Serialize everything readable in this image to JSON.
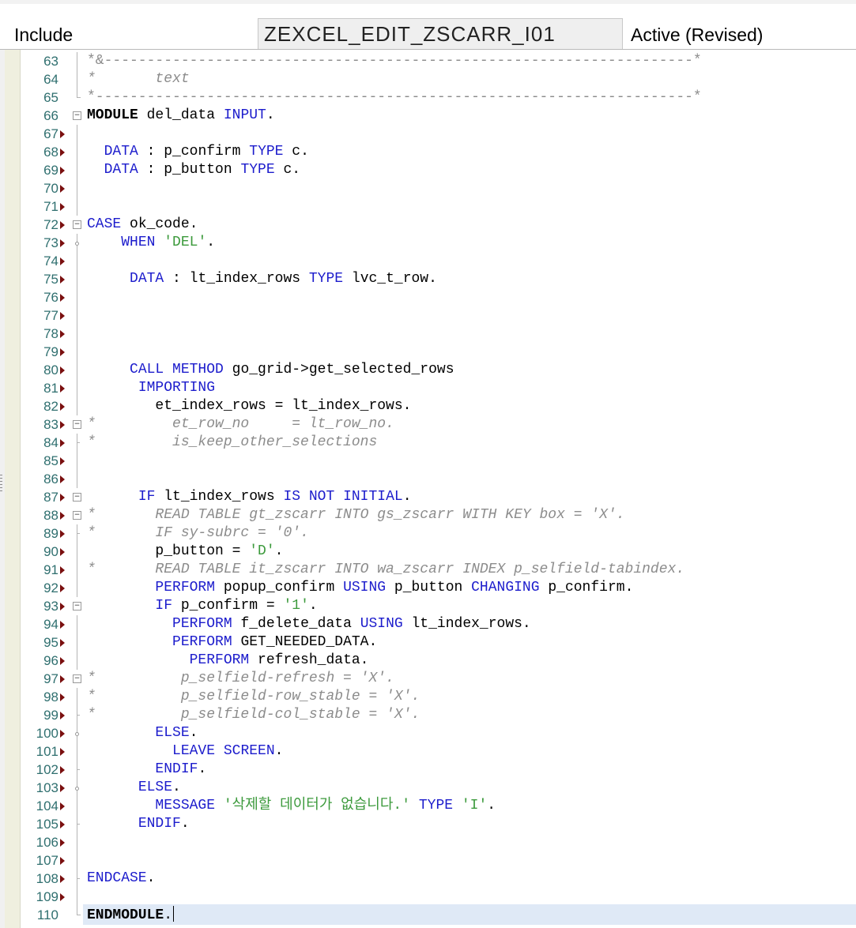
{
  "header": {
    "label": "Include",
    "program": "ZEXCEL_EDIT_ZSCARR_I01",
    "status": "Active (Revised)"
  },
  "editor": {
    "lines": [
      {
        "n": "63",
        "mk": false,
        "fold": "vl",
        "tok": [
          [
            "cm-dash",
            "*&---------------------------------------------------------------------*"
          ]
        ]
      },
      {
        "n": "64",
        "mk": false,
        "fold": "vl",
        "tok": [
          [
            "cm",
            "*       text"
          ]
        ]
      },
      {
        "n": "65",
        "mk": false,
        "fold": "end",
        "tok": [
          [
            "cm-dash",
            "*----------------------------------------------------------------------*"
          ]
        ]
      },
      {
        "n": "66",
        "mk": false,
        "fold": "box",
        "tok": [
          [
            "kb",
            "MODULE"
          ],
          [
            "op",
            " del_data "
          ],
          [
            "kw",
            "INPUT"
          ],
          [
            "op",
            "."
          ]
        ]
      },
      {
        "n": "67",
        "mk": true,
        "fold": "vl",
        "tok": []
      },
      {
        "n": "68",
        "mk": true,
        "fold": "vl",
        "tok": [
          [
            "op",
            "  "
          ],
          [
            "kw",
            "DATA"
          ],
          [
            "op",
            " : p_confirm "
          ],
          [
            "kw",
            "TYPE"
          ],
          [
            "op",
            " c."
          ]
        ]
      },
      {
        "n": "69",
        "mk": true,
        "fold": "vl",
        "tok": [
          [
            "op",
            "  "
          ],
          [
            "kw",
            "DATA"
          ],
          [
            "op",
            " : p_button "
          ],
          [
            "kw",
            "TYPE"
          ],
          [
            "op",
            " c."
          ]
        ]
      },
      {
        "n": "70",
        "mk": true,
        "fold": "vl",
        "tok": []
      },
      {
        "n": "71",
        "mk": true,
        "fold": "vl",
        "tok": []
      },
      {
        "n": "72",
        "mk": true,
        "fold": "box",
        "tok": [
          [
            "kw",
            "CASE"
          ],
          [
            "op",
            " ok_code."
          ]
        ]
      },
      {
        "n": "73",
        "mk": true,
        "fold": "dot",
        "tok": [
          [
            "op",
            "    "
          ],
          [
            "kw",
            "WHEN"
          ],
          [
            "op",
            " "
          ],
          [
            "str",
            "'DEL'"
          ],
          [
            "op",
            "."
          ]
        ]
      },
      {
        "n": "74",
        "mk": true,
        "fold": "vl",
        "tok": []
      },
      {
        "n": "75",
        "mk": true,
        "fold": "vl",
        "tok": [
          [
            "op",
            "     "
          ],
          [
            "kw",
            "DATA"
          ],
          [
            "op",
            " : lt_index_rows "
          ],
          [
            "kw",
            "TYPE"
          ],
          [
            "op",
            " lvc_t_row."
          ]
        ]
      },
      {
        "n": "76",
        "mk": true,
        "fold": "vl",
        "tok": []
      },
      {
        "n": "77",
        "mk": true,
        "fold": "vl",
        "tok": []
      },
      {
        "n": "78",
        "mk": true,
        "fold": "vl",
        "tok": []
      },
      {
        "n": "79",
        "mk": true,
        "fold": "vl",
        "tok": []
      },
      {
        "n": "80",
        "mk": true,
        "fold": "vl",
        "tok": [
          [
            "op",
            "     "
          ],
          [
            "kw",
            "CALL METHOD"
          ],
          [
            "op",
            " go_grid->get_selected_rows"
          ]
        ]
      },
      {
        "n": "81",
        "mk": true,
        "fold": "vl",
        "tok": [
          [
            "op",
            "      "
          ],
          [
            "kw",
            "IMPORTING"
          ]
        ]
      },
      {
        "n": "82",
        "mk": true,
        "fold": "vl",
        "tok": [
          [
            "op",
            "        et_index_rows = lt_index_rows."
          ]
        ]
      },
      {
        "n": "83",
        "mk": true,
        "fold": "box",
        "tok": [
          [
            "cm",
            "*         et_row_no     = lt_row_no."
          ]
        ]
      },
      {
        "n": "84",
        "mk": true,
        "fold": "tick",
        "tok": [
          [
            "cm",
            "*         is_keep_other_selections"
          ]
        ]
      },
      {
        "n": "85",
        "mk": true,
        "fold": "vl",
        "tok": []
      },
      {
        "n": "86",
        "mk": true,
        "fold": "vl",
        "tok": []
      },
      {
        "n": "87",
        "mk": true,
        "fold": "box",
        "tok": [
          [
            "op",
            "      "
          ],
          [
            "kw",
            "IF"
          ],
          [
            "op",
            " lt_index_rows "
          ],
          [
            "kw",
            "IS NOT INITIAL"
          ],
          [
            "op",
            "."
          ]
        ]
      },
      {
        "n": "88",
        "mk": true,
        "fold": "box",
        "tok": [
          [
            "cm",
            "*       READ TABLE gt_zscarr INTO gs_zscarr WITH KEY box = 'X'."
          ]
        ]
      },
      {
        "n": "89",
        "mk": true,
        "fold": "tick",
        "tok": [
          [
            "cm",
            "*       IF sy-subrc = '0'."
          ]
        ]
      },
      {
        "n": "90",
        "mk": true,
        "fold": "vl",
        "tok": [
          [
            "op",
            "        p_button = "
          ],
          [
            "str",
            "'D'"
          ],
          [
            "op",
            "."
          ]
        ]
      },
      {
        "n": "91",
        "mk": true,
        "fold": "vl",
        "tok": [
          [
            "cm",
            "*       READ TABLE it_zscarr INTO wa_zscarr INDEX p_selfield-tabindex."
          ]
        ]
      },
      {
        "n": "92",
        "mk": true,
        "fold": "vl",
        "tok": [
          [
            "op",
            "        "
          ],
          [
            "kw",
            "PERFORM"
          ],
          [
            "op",
            " popup_confirm "
          ],
          [
            "kw",
            "USING"
          ],
          [
            "op",
            " p_button "
          ],
          [
            "kw",
            "CHANGING"
          ],
          [
            "op",
            " p_confirm."
          ]
        ]
      },
      {
        "n": "93",
        "mk": true,
        "fold": "box",
        "tok": [
          [
            "op",
            "        "
          ],
          [
            "kw",
            "IF"
          ],
          [
            "op",
            " p_confirm = "
          ],
          [
            "str",
            "'1'"
          ],
          [
            "op",
            "."
          ]
        ]
      },
      {
        "n": "94",
        "mk": true,
        "fold": "vl",
        "tok": [
          [
            "op",
            "          "
          ],
          [
            "kw",
            "PERFORM"
          ],
          [
            "op",
            " f_delete_data "
          ],
          [
            "kw",
            "USING"
          ],
          [
            "op",
            " lt_index_rows."
          ]
        ]
      },
      {
        "n": "95",
        "mk": true,
        "fold": "vl",
        "tok": [
          [
            "op",
            "          "
          ],
          [
            "kw",
            "PERFORM"
          ],
          [
            "op",
            " GET_NEEDED_DATA."
          ]
        ]
      },
      {
        "n": "96",
        "mk": true,
        "fold": "vl",
        "tok": [
          [
            "op",
            "            "
          ],
          [
            "kw",
            "PERFORM"
          ],
          [
            "op",
            " refresh_data."
          ]
        ]
      },
      {
        "n": "97",
        "mk": true,
        "fold": "box",
        "tok": [
          [
            "cm",
            "*          p_selfield-refresh = 'X'."
          ]
        ]
      },
      {
        "n": "98",
        "mk": true,
        "fold": "vl",
        "tok": [
          [
            "cm",
            "*          p_selfield-row_stable = 'X'."
          ]
        ]
      },
      {
        "n": "99",
        "mk": true,
        "fold": "tick",
        "tok": [
          [
            "cm",
            "*          p_selfield-col_stable = 'X'."
          ]
        ]
      },
      {
        "n": "100",
        "mk": true,
        "fold": "dot",
        "tok": [
          [
            "op",
            "        "
          ],
          [
            "kw",
            "ELSE"
          ],
          [
            "op",
            "."
          ]
        ]
      },
      {
        "n": "101",
        "mk": true,
        "fold": "vl",
        "tok": [
          [
            "op",
            "          "
          ],
          [
            "kw",
            "LEAVE SCREEN"
          ],
          [
            "op",
            "."
          ]
        ]
      },
      {
        "n": "102",
        "mk": true,
        "fold": "tick",
        "tok": [
          [
            "op",
            "        "
          ],
          [
            "kw",
            "ENDIF"
          ],
          [
            "op",
            "."
          ]
        ]
      },
      {
        "n": "103",
        "mk": true,
        "fold": "dot",
        "tok": [
          [
            "op",
            "      "
          ],
          [
            "kw",
            "ELSE"
          ],
          [
            "op",
            "."
          ]
        ]
      },
      {
        "n": "104",
        "mk": true,
        "fold": "vl",
        "tok": [
          [
            "op",
            "        "
          ],
          [
            "kw",
            "MESSAGE"
          ],
          [
            "op",
            " "
          ],
          [
            "str",
            "'삭제할 데이터가 없습니다.'"
          ],
          [
            "op",
            " "
          ],
          [
            "kw",
            "TYPE"
          ],
          [
            "op",
            " "
          ],
          [
            "str",
            "'I'"
          ],
          [
            "op",
            "."
          ]
        ]
      },
      {
        "n": "105",
        "mk": true,
        "fold": "tick",
        "tok": [
          [
            "op",
            "      "
          ],
          [
            "kw",
            "ENDIF"
          ],
          [
            "op",
            "."
          ]
        ]
      },
      {
        "n": "106",
        "mk": true,
        "fold": "vl",
        "tok": []
      },
      {
        "n": "107",
        "mk": true,
        "fold": "vl",
        "tok": []
      },
      {
        "n": "108",
        "mk": true,
        "fold": "tick",
        "tok": [
          [
            "kw",
            "ENDCASE"
          ],
          [
            "op",
            "."
          ]
        ]
      },
      {
        "n": "109",
        "mk": true,
        "fold": "vl",
        "tok": []
      },
      {
        "n": "110",
        "mk": false,
        "fold": "end",
        "tok": [
          [
            "kb",
            "ENDMODULE"
          ],
          [
            "op",
            "."
          ]
        ],
        "caret": true
      }
    ]
  }
}
